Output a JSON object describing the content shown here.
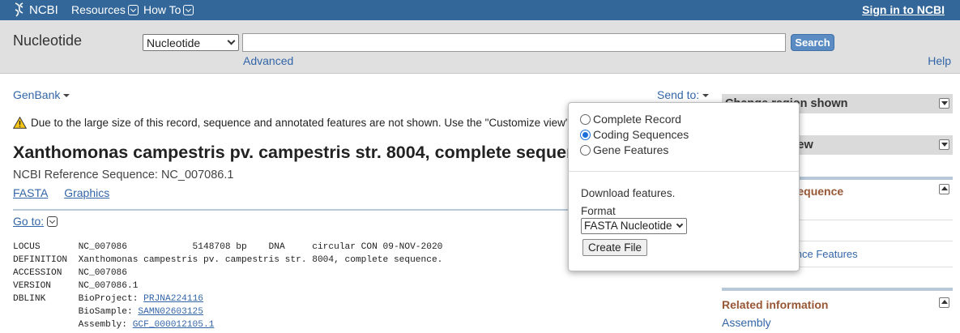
{
  "topbar": {
    "logo_text": "NCBI",
    "resources_label": "Resources",
    "howto_label": "How To",
    "signin_label": "Sign in to NCBI"
  },
  "search": {
    "db_title": "Nucleotide",
    "db_selected": "Nucleotide",
    "query": "",
    "button_label": "Search",
    "advanced_label": "Advanced",
    "help_label": "Help"
  },
  "main": {
    "format_label": "GenBank",
    "sendto_label": "Send to:",
    "warning_text": "Due to the large size of this record, sequence and annotated features are not shown. Use the \"Customize view\" panel",
    "title": "Xanthomonas campestris pv. campestris str. 8004, complete sequence",
    "refseq_line": "NCBI Reference Sequence: NC_007086.1",
    "links": [
      "FASTA",
      "Graphics"
    ],
    "goto_label": "Go to:"
  },
  "record": {
    "locus_line": "LOCUS       NC_007086            5148708 bp    DNA     circular CON 09-NOV-2020",
    "definition_line": "DEFINITION  Xanthomonas campestris pv. campestris str. 8004, complete sequence.",
    "accession_line": "ACCESSION   NC_007086",
    "version_line": "VERSION     NC_007086.1",
    "dblink_key": "DBLINK      ",
    "bioproject_label": "BioProject: ",
    "bioproject_value": "PRJNA224116",
    "biosample_label": "            BioSample: ",
    "biosample_value": "SAMN02603125",
    "assembly_label": "            Assembly: ",
    "assembly_value": "GCF_000012105.1"
  },
  "sidebar": {
    "change_region_label": "Change region shown",
    "customize_view_label": "Customize view",
    "analyze_title": "Analyze this sequence",
    "highlight_label": "Highlight Sequence Features",
    "related_title": "Related information",
    "assembly_link": "Assembly"
  },
  "popup": {
    "options": [
      "Complete Record",
      "Coding Sequences",
      "Gene Features"
    ],
    "selected_index": 1,
    "download_text": "Download features.",
    "format_label": "Format",
    "format_selected": "FASTA Nucleotide",
    "create_button": "Create File"
  },
  "colors": {
    "topbar": "#336699",
    "link": "#3366a8",
    "section_title": "#985735"
  }
}
